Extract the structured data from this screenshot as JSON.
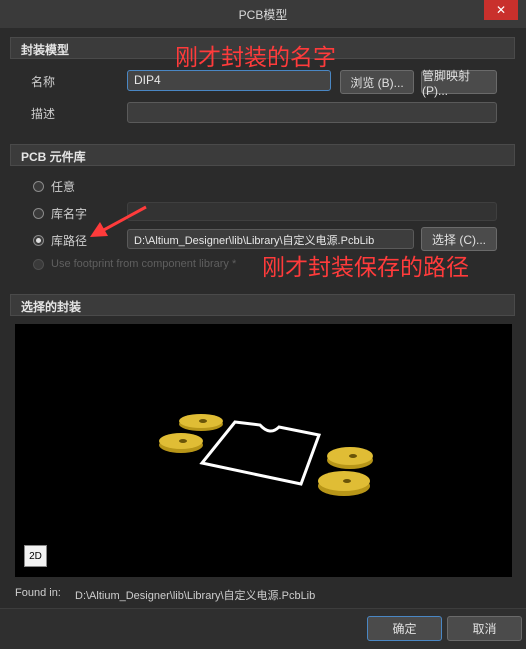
{
  "window": {
    "title": "PCB模型",
    "close_glyph": "✕"
  },
  "model_section": {
    "header": "封装模型",
    "name_label": "名称",
    "name_value": "DIP4",
    "browse_button": "浏览 (B)...",
    "pin_map_button": "管脚映射 (P)...",
    "desc_label": "描述",
    "desc_value": ""
  },
  "library_section": {
    "header": "PCB 元件库",
    "options": {
      "any": "任意",
      "lib_name": "库名字",
      "lib_path": "库路径",
      "use_footprint": "Use footprint from component library *"
    },
    "lib_path_value": "D:\\Altium_Designer\\lib\\Library\\自定义电源.PcbLib",
    "select_button": "选择 (C)..."
  },
  "annotations": {
    "name_note": "刚才封装的名字",
    "path_note": "刚才封装保存的路径"
  },
  "preview_section": {
    "header": "选择的封装",
    "view_mode_button": "2D"
  },
  "found_in": {
    "label": "Found in:",
    "path": "D:\\Altium_Designer\\lib\\Library\\自定义电源.PcbLib"
  },
  "footer": {
    "ok_button": "确定",
    "cancel_button": "取消"
  },
  "colors": {
    "annotation_red": "#ff3b3b",
    "pad_gold": "#d9b52a",
    "outline_white": "#ffffff"
  }
}
